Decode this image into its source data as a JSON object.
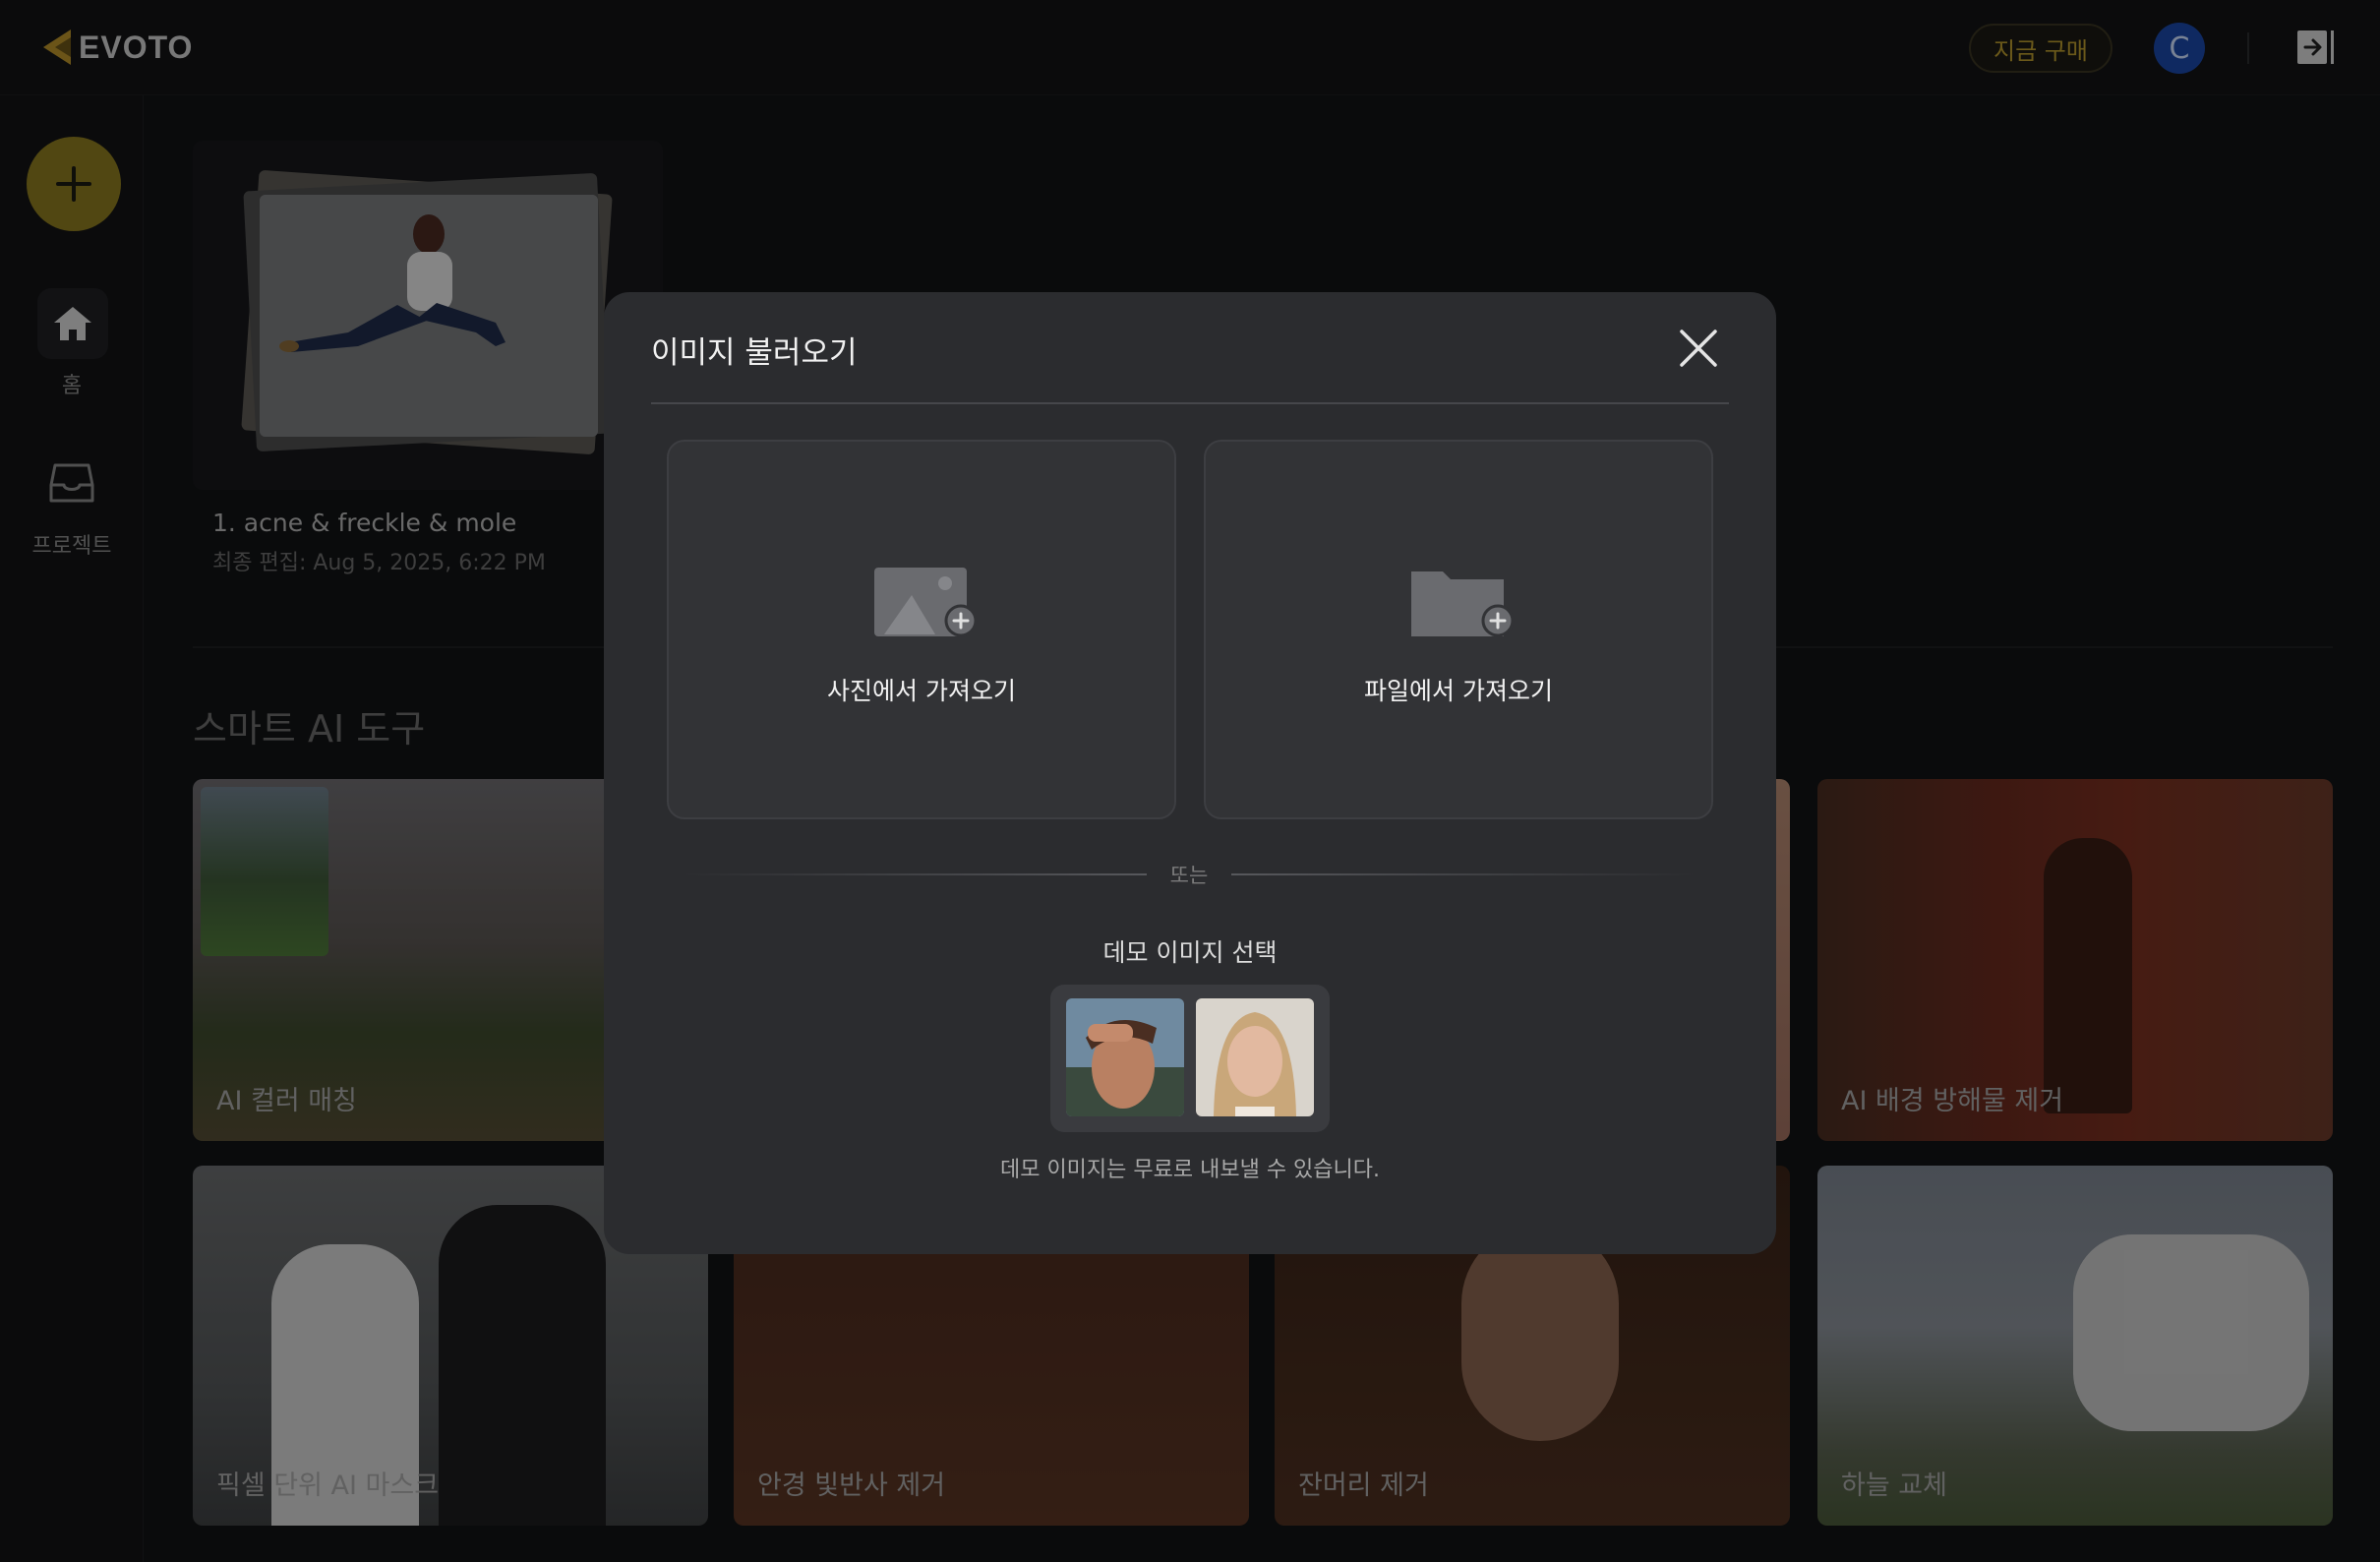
{
  "app": {
    "logo_text": "EVOTO",
    "buy_button": "지금 구매",
    "avatar_initial": "C"
  },
  "sidebar": {
    "new_label": "+",
    "items": [
      {
        "label": "홈",
        "icon": "home-icon"
      },
      {
        "label": "프로젝트",
        "icon": "inbox-icon"
      }
    ]
  },
  "project": {
    "name": "1. acne & freckle & mole",
    "date": "최종 편집: Aug 5, 2025, 6:22 PM"
  },
  "tools": {
    "title": "스마트 AI 도구",
    "cards": [
      {
        "label": "AI 컬러 매칭"
      },
      {
        "label": "AI 배경 방해물 제거"
      },
      {
        "label": "픽셀 단위 AI 마스크"
      },
      {
        "label": "안경 빛반사 제거"
      },
      {
        "label": "잔머리 제거"
      },
      {
        "label": "하늘 교체"
      }
    ]
  },
  "modal": {
    "title": "이미지 불러오기",
    "photo_import": "사진에서 가져오기",
    "file_import": "파일에서 가져오기",
    "or": "또는",
    "demo_title": "데모 이미지 선택",
    "demo_note": "데모 이미지는 무료로 내보낼 수 있습니다."
  },
  "colors": {
    "accent": "#8c7a1f",
    "avatar": "#1b48a8",
    "modal_bg": "#2b2c2f"
  }
}
